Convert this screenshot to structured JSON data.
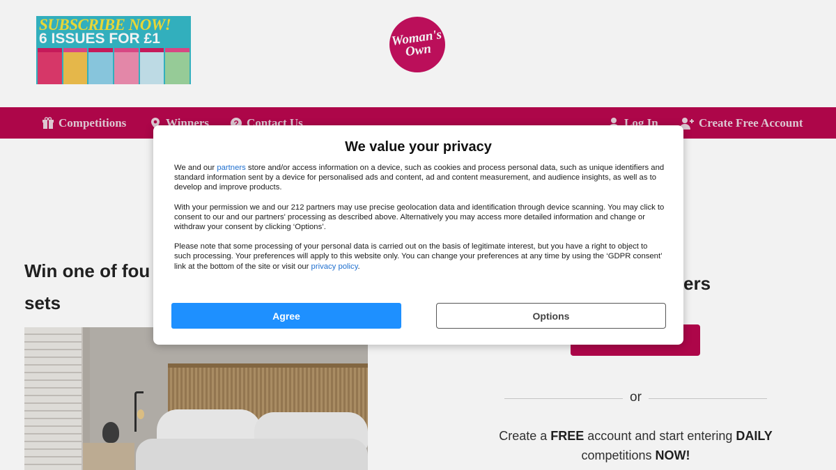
{
  "header": {
    "promo_line1": "SUBSCRIBE NOW!",
    "promo_line2": "6 ISSUES FOR £1",
    "logo_text": "Woman's\nOwn"
  },
  "nav": {
    "left_items": [
      {
        "label": "Competitions",
        "icon": "gift-icon"
      },
      {
        "label": "Winners",
        "icon": "location-pin-icon"
      },
      {
        "label": "Contact Us",
        "icon": "question-icon"
      }
    ],
    "right_items": [
      {
        "label": "Log In",
        "icon": "user-icon"
      },
      {
        "label": "Create Free Account",
        "icon": "user-plus-icon"
      }
    ],
    "color": "#b7074d"
  },
  "main": {
    "win_title_part1": "Win one of fou",
    "win_title_part2": "sets",
    "side_heading": "ers",
    "or_text": "or",
    "cta_part1": "Create a ",
    "cta_bold1": "FREE",
    "cta_part2": " account and start entering ",
    "cta_bold2": "DAILY",
    "cta_part3": " competitions ",
    "cta_bold3": "NOW!"
  },
  "modal": {
    "title": "We value your privacy",
    "p1_before_link": "We and our ",
    "p1_link": "partners",
    "p1_after_link": " store and/or access information on a device, such as cookies and process personal data, such as unique identifiers and standard information sent by a device for personalised ads and content, ad and content measurement, and audience insights, as well as to develop and improve products.",
    "p2": "With your permission we and our 212 partners may use precise geolocation data and identification through device scanning. You may click to consent to our and our partners' processing as described above. Alternatively you may access more detailed information and change or withdraw your consent by clicking ‘Options’.",
    "p3_before_link": "Please note that some processing of your personal data is carried out on the basis of legitimate interest, but you have a right to object to such processing. Your preferences will apply to this website only. You can change your preferences at any time by using the ‘GDPR consent’ link at the bottom of the site or visit our ",
    "p3_link": "privacy policy",
    "p3_after_link": ".",
    "agree_label": "Agree",
    "options_label": "Options",
    "accent_color": "#1e90ff"
  }
}
